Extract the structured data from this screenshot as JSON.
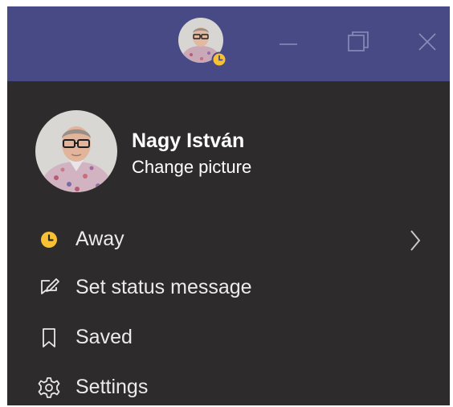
{
  "titlebar": {
    "background": "#474a85",
    "presence_status": "away",
    "avatar_icon": "user-avatar-photo",
    "window_controls": {
      "minimize_icon": "minimize-icon",
      "maximize_icon": "restore-icon",
      "close_icon": "close-icon"
    }
  },
  "profile": {
    "name": "Nagy István",
    "change_picture_label": "Change picture"
  },
  "menu": {
    "background": "#2d2b2c",
    "items": [
      {
        "label": "Away",
        "icon": "clock-status-icon",
        "status_color": "#f8c133",
        "has_submenu": true
      },
      {
        "label": "Set status message",
        "icon": "edit-message-icon"
      },
      {
        "label": "Saved",
        "icon": "bookmark-icon"
      },
      {
        "label": "Settings",
        "icon": "gear-icon"
      }
    ]
  }
}
